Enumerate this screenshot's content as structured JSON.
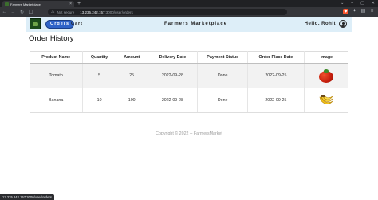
{
  "browser": {
    "tab_title": "Farmers Marketplace",
    "security_label": "Not secure",
    "url_host": "13.235.242.157",
    "url_path": ":3000/user/orders",
    "status_url": "13.235.242.157:3000/user/orders"
  },
  "navbar": {
    "orders_label": "Orders",
    "cart_label": "Cart",
    "brand": "Farmers Marketplace",
    "greeting": "Hello, Rohit"
  },
  "page": {
    "title": "Order History"
  },
  "table": {
    "headers": [
      "Product Name",
      "Quantity",
      "Amount",
      "Delivery Date",
      "Payment Status",
      "Order Place Date",
      "Image"
    ],
    "rows": [
      {
        "product": "Tomato",
        "quantity": "5",
        "amount": "25",
        "delivery_date": "2022-09-28",
        "payment_status": "Done",
        "order_date": "2022-09-25",
        "image_icon": "tomato-image"
      },
      {
        "product": "Banana",
        "quantity": "10",
        "amount": "100",
        "delivery_date": "2022-09-28",
        "payment_status": "Done",
        "order_date": "2022-09-25",
        "image_icon": "banana-image"
      }
    ]
  },
  "footer": {
    "text": "Copyright © 2022 -- FarmersMarket"
  },
  "colors": {
    "navbar_bg": "#ddeef8",
    "orders_button_bg": "#2f63c8",
    "row_stripe": "#f2f2f2"
  }
}
